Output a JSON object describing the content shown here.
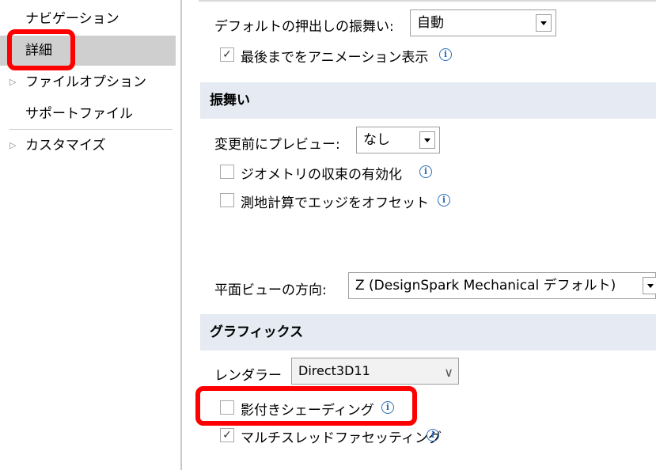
{
  "sidebar": {
    "items": [
      {
        "label": "ナビゲーション"
      },
      {
        "label": "詳細"
      },
      {
        "label": "ファイルオプション"
      },
      {
        "label": "サポートファイル"
      },
      {
        "label": "カスタマイズ"
      }
    ]
  },
  "main": {
    "default_pull": {
      "label": "デフォルトの押出しの振舞い:",
      "value": "自動"
    },
    "animate_to_end": {
      "label": "最後までをアニメーション表示",
      "checked": true
    },
    "behavior_section": {
      "title": "振舞い"
    },
    "preview_before_change": {
      "label": "変更前にプレビュー:",
      "value": "なし"
    },
    "geometry_convergence": {
      "label": "ジオメトリの収束の有効化",
      "checked": false
    },
    "geodesic_offset": {
      "label": "測地計算でエッジをオフセット",
      "checked": false
    },
    "plan_view_direction": {
      "label": "平面ビューの方向:",
      "value": "Z (DesignSpark Mechanical デフォルト)"
    },
    "graphics_section": {
      "title": "グラフィックス"
    },
    "renderer": {
      "label": "レンダラー",
      "value": "Direct3D11"
    },
    "shadow_shading": {
      "label": "影付きシェーディング",
      "checked": false
    },
    "multithread_faceting": {
      "label": "マルチスレッドファセッティング",
      "checked": true
    }
  },
  "icons": {
    "info": "info-icon",
    "check": "✓"
  },
  "colors": {
    "highlight": "#ff0000",
    "section_bg": "#e5eaf3",
    "selected_bg": "#cfcfcf"
  }
}
